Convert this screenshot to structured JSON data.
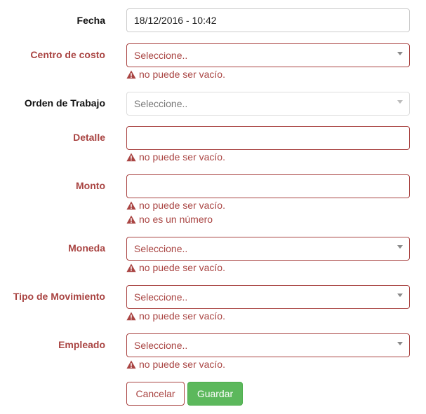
{
  "form": {
    "fecha": {
      "label": "Fecha",
      "value": "18/12/2016 - 10:42"
    },
    "centro_costo": {
      "label": "Centro de costo",
      "placeholder": "Seleccione..",
      "errors": [
        "no puede ser vacío."
      ]
    },
    "orden_trabajo": {
      "label": "Orden de Trabajo",
      "placeholder": "Seleccione.."
    },
    "detalle": {
      "label": "Detalle",
      "value": "",
      "errors": [
        "no puede ser vacío."
      ]
    },
    "monto": {
      "label": "Monto",
      "value": "",
      "errors": [
        "no puede ser vacío.",
        "no es un número"
      ]
    },
    "moneda": {
      "label": "Moneda",
      "placeholder": "Seleccione..",
      "errors": [
        "no puede ser vacío."
      ]
    },
    "tipo_movimiento": {
      "label": "Tipo de Movimiento",
      "placeholder": "Seleccione..",
      "errors": [
        "no puede ser vacío."
      ]
    },
    "empleado": {
      "label": "Empleado",
      "placeholder": "Seleccione..",
      "errors": [
        "no puede ser vacío."
      ]
    }
  },
  "buttons": {
    "cancel": "Cancelar",
    "save": "Guardar"
  },
  "colors": {
    "error": "#a94442",
    "success": "#5cb85c",
    "border": "#cccccc"
  },
  "icons": {
    "error": "warning-icon",
    "select": "caret-down-icon"
  }
}
